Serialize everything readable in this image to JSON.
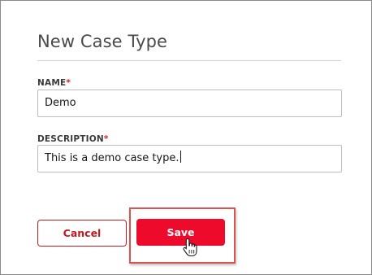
{
  "dialog": {
    "title": "New Case Type"
  },
  "fields": {
    "name": {
      "label": "NAME",
      "required_marker": "*",
      "value": "Demo"
    },
    "description": {
      "label": "DESCRIPTION",
      "required_marker": "*",
      "value": "This is a demo case type."
    }
  },
  "buttons": {
    "cancel_label": "Cancel",
    "save_label": "Save"
  },
  "colors": {
    "accent": "#ee0a2a",
    "cancel_text": "#c01b22",
    "required": "#da1e28",
    "highlight": "#d9534f"
  },
  "icons": {
    "cursor": "hand-pointer-icon"
  }
}
